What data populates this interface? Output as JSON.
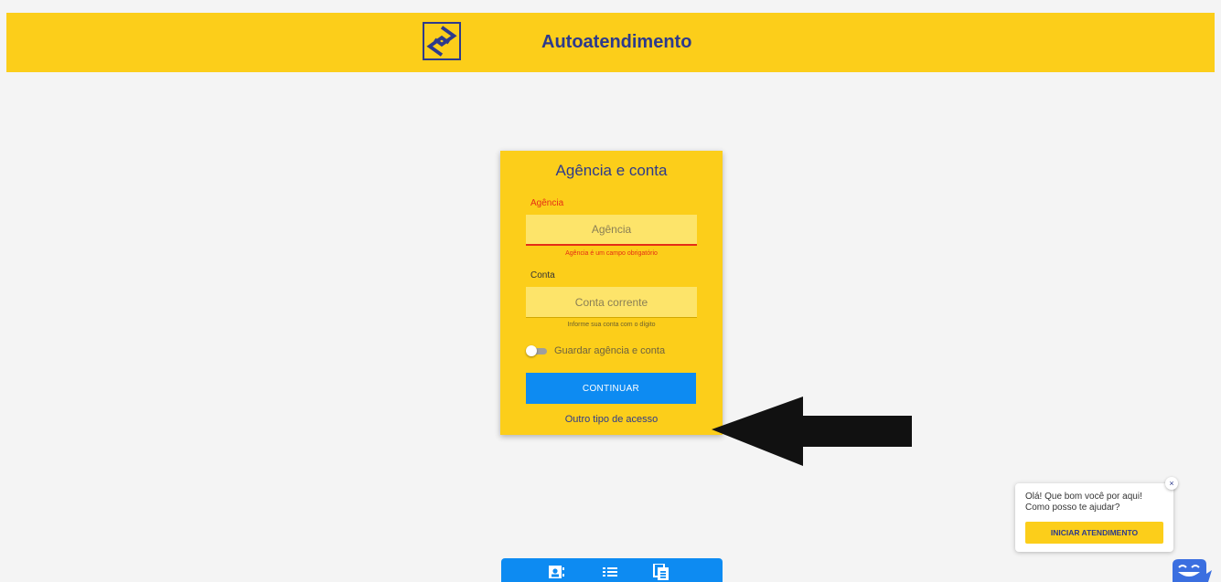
{
  "header": {
    "title": "Autoatendimento",
    "logo_icon": "banco-do-brasil-logo",
    "background": "#fcce1a",
    "accent": "#2d3a8c"
  },
  "login_card": {
    "title": "Agência e conta",
    "agencia": {
      "label": "Agência",
      "placeholder": "Agência",
      "value": "",
      "error": "Agência é um campo obrigatório"
    },
    "conta": {
      "label": "Conta",
      "placeholder": "Conta corrente",
      "value": "",
      "hint": "Informe sua conta com o dígito"
    },
    "remember": {
      "label": "Guardar agência e conta",
      "checked": false
    },
    "continue_label": "CONTINUAR",
    "other_access_label": "Outro tipo de acesso",
    "button_color": "#0d8bf2",
    "error_color": "#e52d16"
  },
  "annotation": {
    "icon": "black-arrow-pointing-left"
  },
  "chat": {
    "line1": "Olá! Que bom você por aqui!",
    "line2": "Como posso te ajudar?",
    "button_label": "INICIAR ATENDIMENTO",
    "close_label": "×",
    "avatar_icon": "chatbot-face-icon"
  },
  "bottom_nav": {
    "items": [
      {
        "icon": "contact-card-icon"
      },
      {
        "icon": "list-icon"
      },
      {
        "icon": "document-icon"
      }
    ]
  }
}
